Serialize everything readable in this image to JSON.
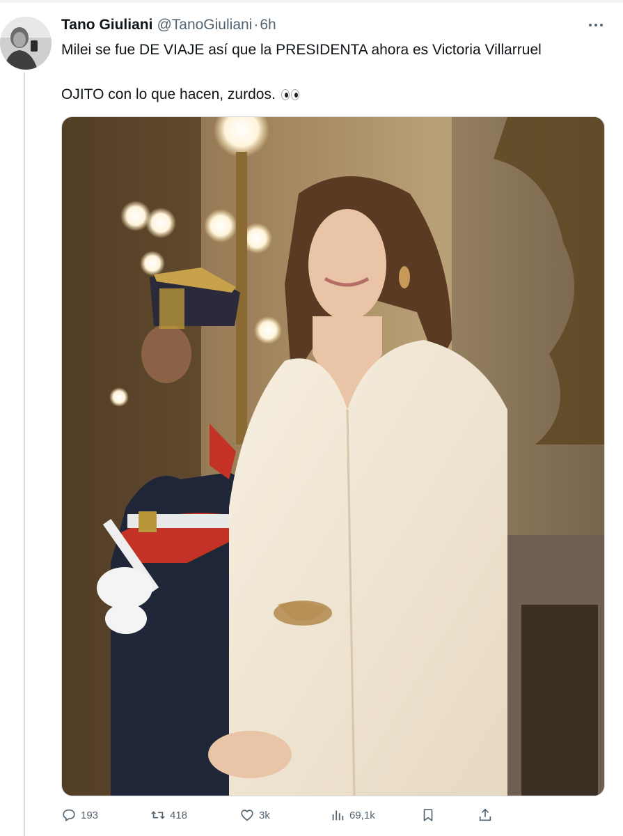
{
  "tweet": {
    "author_name": "Tano Giuliani",
    "handle": "@TanoGiuliani",
    "separator": "·",
    "time": "6h",
    "text_line_1": "Milei se fue DE VIAJE así que la PRESIDENTA ahora es Victoria Villarruel",
    "text_line_2": "OJITO con lo que hacen, zurdos."
  },
  "metrics": {
    "replies": "193",
    "retweets": "418",
    "likes": "3k",
    "views": "69,1k"
  },
  "icons": {
    "more": "more-dots-icon",
    "reply": "reply-icon",
    "retweet": "retweet-icon",
    "like": "heart-icon",
    "views": "analytics-icon",
    "bookmark": "bookmark-icon",
    "share": "share-icon",
    "emoji": "eyes-emoji"
  },
  "colors": {
    "text": "#0f1419",
    "secondary": "#536471",
    "border": "#cfd9de"
  }
}
